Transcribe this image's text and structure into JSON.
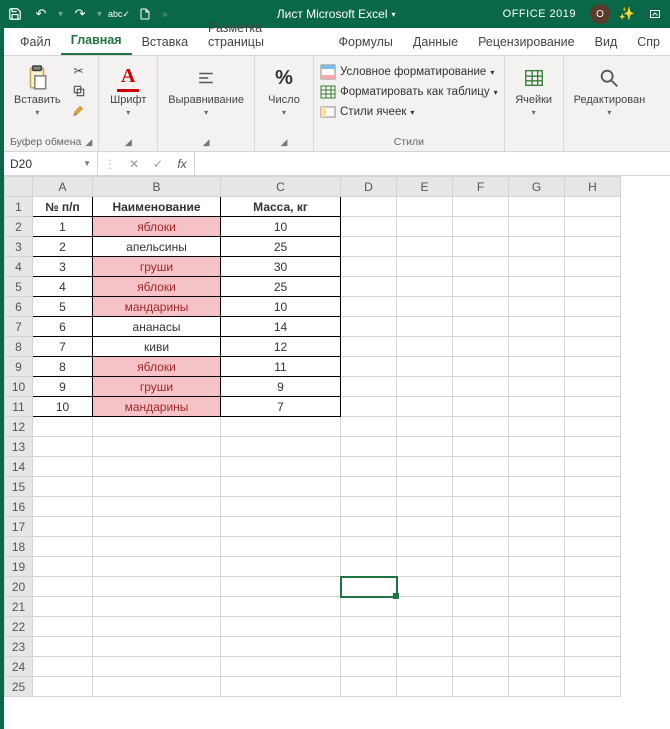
{
  "titlebar": {
    "doc_title": "Лист Microsoft Excel",
    "office_label": "OFFICE 2019",
    "avatar_initial": "O"
  },
  "tabs": {
    "file": "Файл",
    "home": "Главная",
    "insert": "Вставка",
    "layout": "Разметка страницы",
    "formulas": "Формулы",
    "data": "Данные",
    "review": "Рецензирование",
    "view": "Вид",
    "help": "Спр"
  },
  "ribbon": {
    "clipboard": {
      "paste": "Вставить",
      "group_label": "Буфер обмена"
    },
    "font": {
      "label": "Шрифт"
    },
    "alignment": {
      "label": "Выравнивание"
    },
    "number": {
      "label": "Число"
    },
    "styles": {
      "cond_format": "Условное форматирование",
      "format_table": "Форматировать как таблицу",
      "cell_styles": "Стили ячеек",
      "group_label": "Стили"
    },
    "cells": {
      "label": "Ячейки"
    },
    "editing": {
      "label": "Редактирован"
    }
  },
  "formula_bar": {
    "namebox": "D20",
    "formula": ""
  },
  "columns": [
    "A",
    "B",
    "C",
    "D",
    "E",
    "F",
    "G",
    "H"
  ],
  "row_count": 25,
  "selected_cell": {
    "col": "D",
    "row": 20
  },
  "table": {
    "headers": {
      "A": "№ п/п",
      "B": "Наименование",
      "C": "Масса, кг"
    },
    "rows": [
      {
        "num": 1,
        "name": "яблоки",
        "mass": 10,
        "hl": true
      },
      {
        "num": 2,
        "name": "апельсины",
        "mass": 25,
        "hl": false
      },
      {
        "num": 3,
        "name": "груши",
        "mass": 30,
        "hl": true
      },
      {
        "num": 4,
        "name": "яблоки",
        "mass": 25,
        "hl": true
      },
      {
        "num": 5,
        "name": "мандарины",
        "mass": 10,
        "hl": true
      },
      {
        "num": 6,
        "name": "ананасы",
        "mass": 14,
        "hl": false
      },
      {
        "num": 7,
        "name": "киви",
        "mass": 12,
        "hl": false
      },
      {
        "num": 8,
        "name": "яблоки",
        "mass": 11,
        "hl": true
      },
      {
        "num": 9,
        "name": "груши",
        "mass": 9,
        "hl": true
      },
      {
        "num": 10,
        "name": "мандарины",
        "mass": 7,
        "hl": true
      }
    ]
  }
}
